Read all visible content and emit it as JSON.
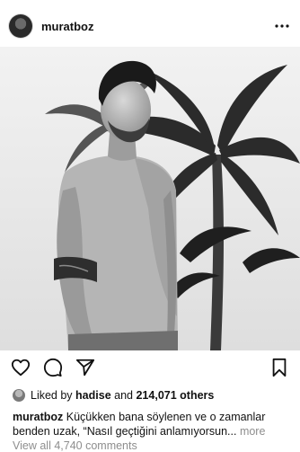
{
  "post": {
    "username": "muratboz",
    "more_icon": "more-horizontal-icon"
  },
  "actions": {
    "like_icon": "heart-icon",
    "comment_icon": "comment-icon",
    "share_icon": "send-icon",
    "save_icon": "bookmark-icon"
  },
  "likes": {
    "prefix": "Liked by",
    "user": "hadise",
    "conjunction": "and",
    "count": "214,071 others"
  },
  "caption": {
    "username": "muratboz",
    "line1": "Küçükken bana söylenen ve o zamanlar",
    "line2": "benden uzak, “Nasıl geçtiğini anlamıyorsun...",
    "more": "more"
  },
  "comments": {
    "label": "View all 4,740 comments"
  },
  "colors": {
    "text": "#111111",
    "muted": "#8e8e8e",
    "background": "#ffffff"
  }
}
